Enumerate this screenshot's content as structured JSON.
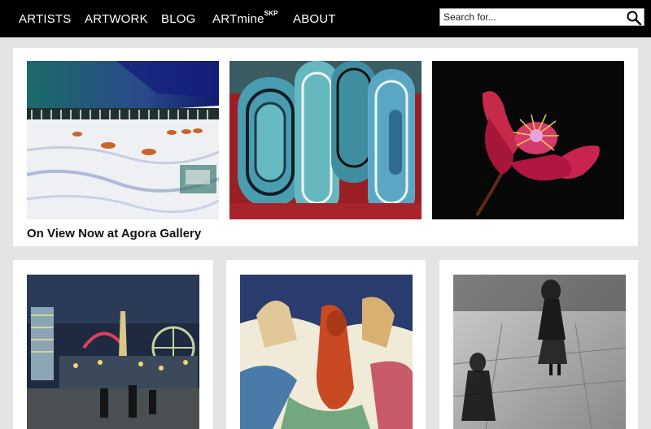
{
  "nav": {
    "items": [
      {
        "label": "ARTISTS"
      },
      {
        "label": "ARTWORK"
      },
      {
        "label": "BLOG"
      },
      {
        "label": "ARTmine",
        "sup": "SKP"
      },
      {
        "label": "ABOUT"
      }
    ]
  },
  "search": {
    "placeholder": "Search for...",
    "icon": "search-icon"
  },
  "featured": {
    "caption": "On View Now at Agora Gallery",
    "artworks": [
      {
        "subject": "deer on snowy landscape"
      },
      {
        "subject": "abstract blue and red swirls"
      },
      {
        "subject": "pink flower on black"
      }
    ]
  },
  "grid": {
    "artworks": [
      {
        "subject": "amusement park at night"
      },
      {
        "subject": "horse painting"
      },
      {
        "subject": "black and white figures on street"
      }
    ]
  },
  "colors": {
    "navbar": "#000000",
    "page_background": "#e4e4e4",
    "panel": "#ffffff"
  }
}
